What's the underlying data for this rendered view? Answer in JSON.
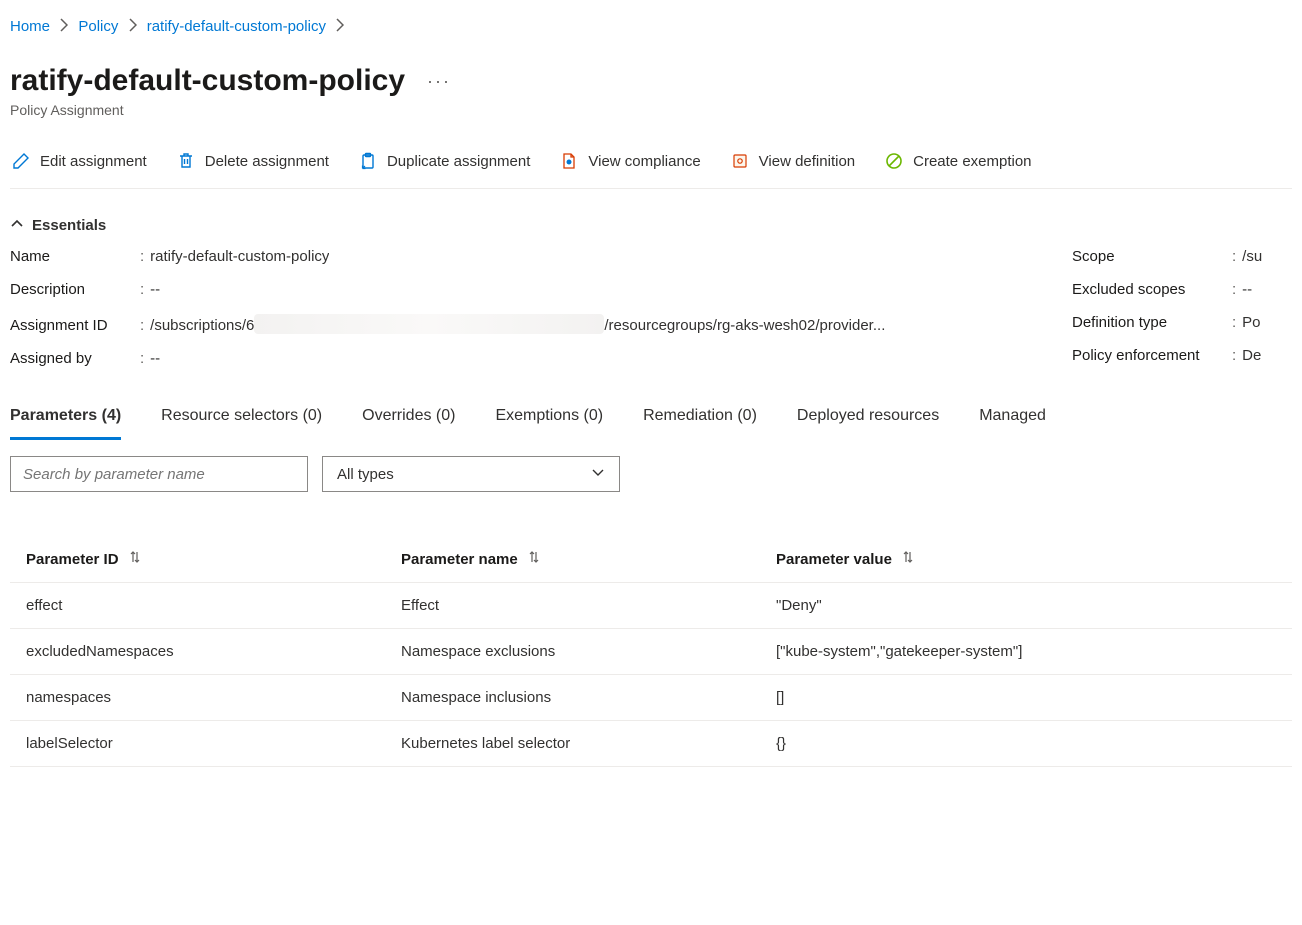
{
  "breadcrumb": {
    "items": [
      {
        "label": "Home"
      },
      {
        "label": "Policy"
      },
      {
        "label": "ratify-default-custom-policy"
      }
    ]
  },
  "header": {
    "title": "ratify-default-custom-policy",
    "subtitle": "Policy Assignment"
  },
  "toolbar": {
    "edit": "Edit assignment",
    "delete": "Delete assignment",
    "duplicate": "Duplicate assignment",
    "view_compliance": "View compliance",
    "view_definition": "View definition",
    "create_exemption": "Create exemption"
  },
  "colors": {
    "link": "#0078d4",
    "text": "#323130",
    "muted": "#605e5c",
    "exempt_green": "#6bb700",
    "warn_orange": "#d83b01"
  },
  "essentials": {
    "label": "Essentials",
    "left": [
      {
        "label": "Name",
        "value": "ratify-default-custom-policy"
      },
      {
        "label": "Description",
        "value": "--"
      },
      {
        "label": "Assignment ID",
        "value_prefix": "/subscriptions/6",
        "value_suffix": "/resourcegroups/rg-aks-wesh02/provider...",
        "redacted": true
      },
      {
        "label": "Assigned by",
        "value": "--"
      }
    ],
    "right": [
      {
        "label": "Scope",
        "value": "/su"
      },
      {
        "label": "Excluded scopes",
        "value": "--"
      },
      {
        "label": "Definition type",
        "value": "Po"
      },
      {
        "label": "Policy enforcement",
        "value": "De"
      }
    ]
  },
  "tabs": [
    {
      "label": "Parameters (4)",
      "active": true
    },
    {
      "label": "Resource selectors (0)"
    },
    {
      "label": "Overrides (0)"
    },
    {
      "label": "Exemptions (0)"
    },
    {
      "label": "Remediation (0)"
    },
    {
      "label": "Deployed resources"
    },
    {
      "label": "Managed"
    }
  ],
  "filters": {
    "search_placeholder": "Search by parameter name",
    "type_selected": "All types"
  },
  "param_table": {
    "headers": [
      "Parameter ID",
      "Parameter name",
      "Parameter value"
    ],
    "rows": [
      {
        "id": "effect",
        "name": "Effect",
        "value": "\"Deny\""
      },
      {
        "id": "excludedNamespaces",
        "name": "Namespace exclusions",
        "value": "[\"kube-system\",\"gatekeeper-system\"]"
      },
      {
        "id": "namespaces",
        "name": "Namespace inclusions",
        "value": "[]"
      },
      {
        "id": "labelSelector",
        "name": "Kubernetes label selector",
        "value": "{}"
      }
    ]
  }
}
